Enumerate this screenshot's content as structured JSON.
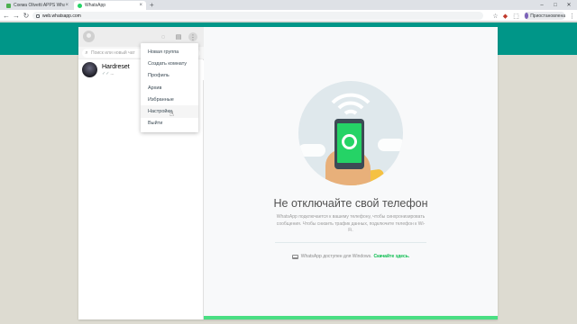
{
  "browser": {
    "tabs": [
      {
        "title": "Схема Olivetti APPS WhatsApp",
        "favicon_color": "#4caf50",
        "active": false
      },
      {
        "title": "WhatsApp",
        "favicon_color": "#25d366",
        "active": true
      }
    ],
    "new_tab": "+",
    "url": "web.whatsapp.com",
    "profile_label": "Приостановлена",
    "window_controls": {
      "minimize": "–",
      "maximize": "□",
      "close": "✕"
    }
  },
  "sidebar": {
    "search_placeholder": "Поиск или новый чат",
    "chats": [
      {
        "name": "Hardreset",
        "preview": "..."
      }
    ]
  },
  "menu": {
    "items": [
      {
        "label": "Новая группа"
      },
      {
        "label": "Создать комнату"
      },
      {
        "label": "Профиль"
      },
      {
        "label": "Архив"
      },
      {
        "label": "Избранные"
      },
      {
        "label": "Настройки"
      },
      {
        "label": "Выйти"
      }
    ],
    "hovered": "Настройки"
  },
  "intro": {
    "title": "Не отключайте свой телефон",
    "text": "WhatsApp подключается к вашему телефону, чтобы синхронизировать сообщения. Чтобы снизить трафик данных, подключите телефон к Wi-Fi.",
    "windows_text": "WhatsApp доступен для Windows.",
    "windows_link": "Скачайте здесь."
  },
  "colors": {
    "teal": "#009688",
    "accent_green": "#25d366",
    "link_green": "#07bc4c"
  }
}
